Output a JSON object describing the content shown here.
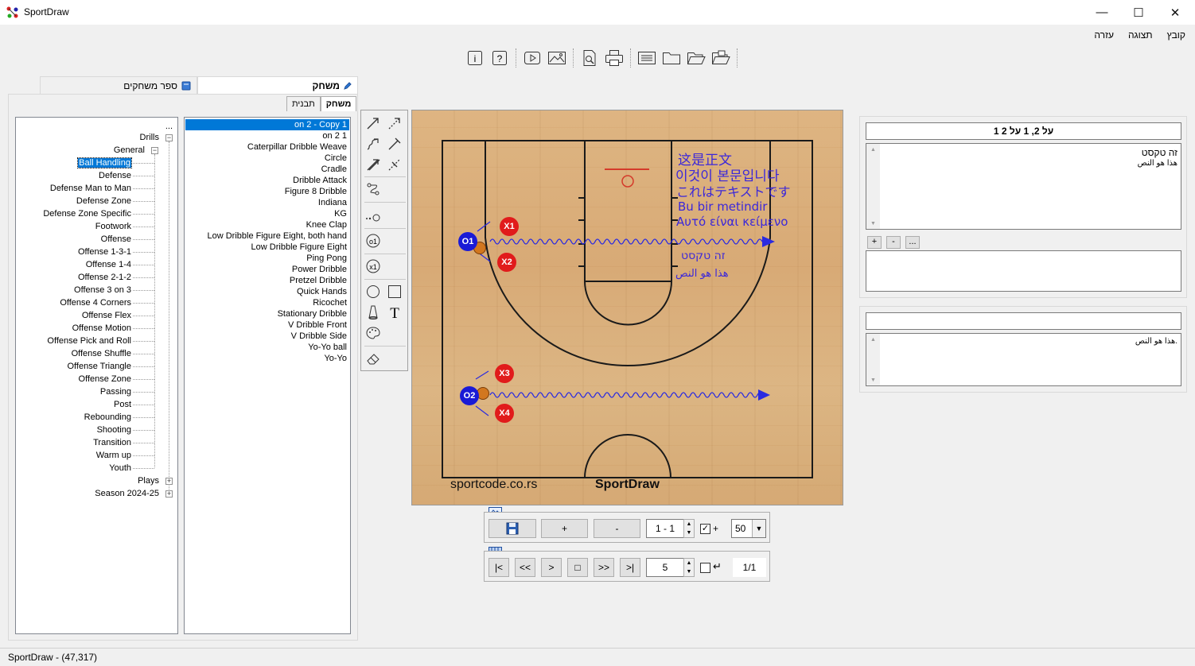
{
  "window": {
    "title": "SportDraw"
  },
  "menu": [
    "קובץ",
    "תצוגה",
    "עזרה"
  ],
  "toolbar_icons": [
    "info-icon",
    "help-icon",
    "play-video-icon",
    "image-icon",
    "preview-icon",
    "print-icon",
    "list-icon",
    "folder-icon",
    "folder-open-icon",
    "folder-save-icon"
  ],
  "left_tabs": {
    "game": "משחק",
    "game_book": "ספר משחקים"
  },
  "sub_tabs": {
    "game": "משחק",
    "template": "תבנית"
  },
  "tree": {
    "root_dots": "...",
    "drills": "Drills",
    "general": "General",
    "categories": [
      "Ball Handling",
      "Defense",
      "Defense Man to Man",
      "Defense Zone",
      "Defense Zone Specific",
      "Footwork",
      "Offense",
      "Offense 1-3-1",
      "Offense 1-4",
      "Offense 2-1-2",
      "Offense 3 on 3",
      "Offense 4 Corners",
      "Offense Flex",
      "Offense Motion",
      "Offense Pick and Roll",
      "Offense Shuffle",
      "Offense Triangle",
      "Offense Zone",
      "Passing",
      "Post",
      "Rebounding",
      "Shooting",
      "Transition",
      "Warm up",
      "Youth"
    ],
    "plays": "Plays",
    "season": "Season 2024-25"
  },
  "drill_list": {
    "selected": "on 2 - Copy 1",
    "items": [
      "on 2 1",
      "Caterpillar Dribble Weave",
      "Circle",
      "Cradle",
      "Dribble Attack",
      "Figure 8 Dribble",
      "Indiana",
      "KG",
      "Knee Clap",
      "Low Dribble Figure Eight, both hand",
      "Low Dribble Figure Eight",
      "Ping Pong",
      "Power Dribble",
      "Pretzel Dribble",
      "Quick Hands",
      "Ricochet",
      "Stationary Dribble",
      "V Dribble Front",
      "V Dribble Side",
      "Yo-Yo ball",
      "Yo-Yo"
    ]
  },
  "court": {
    "players": {
      "o1": "O1",
      "o2": "O2",
      "x1": "X1",
      "x2": "X2",
      "x3": "X3",
      "x4": "X4"
    },
    "texts": {
      "chinese": "这是正文",
      "korean": "이것이 본문입니다",
      "japanese": "これはテキストです",
      "turkish": "Bu bir metindir",
      "greek": "Αυτό είναι κείμενο",
      "hebrew": "זה טקסט",
      "arabic": "هذا هو النص"
    },
    "watermark_left": "sportcode.co.rs",
    "watermark_right": "SportDraw",
    "colors": {
      "offense": "#1a1ad6",
      "defense": "#e11b1b",
      "dribble": "#2a2ae0",
      "annotation": "#3b27d9"
    }
  },
  "frame_controls": {
    "add": "+",
    "remove": "-",
    "frame_value": "1 - 1",
    "checkbox_label": "+",
    "zoom": "50"
  },
  "playback": {
    "first": "|<",
    "prev": "<<",
    "play": ">",
    "stop": "□",
    "next": ">>",
    "last": ">|",
    "speed": "5",
    "counter": "1/1"
  },
  "right_panel": {
    "title": "1 על 2, 1 על 2",
    "text_line1": "זה טקסט",
    "text_line2": "هذا هو النص",
    "buttons": {
      "add": "+",
      "remove": "-",
      "more": "..."
    },
    "notes_title": "",
    "notes_text": "هذا هو النص."
  },
  "status": "SportDraw - (47,317)"
}
